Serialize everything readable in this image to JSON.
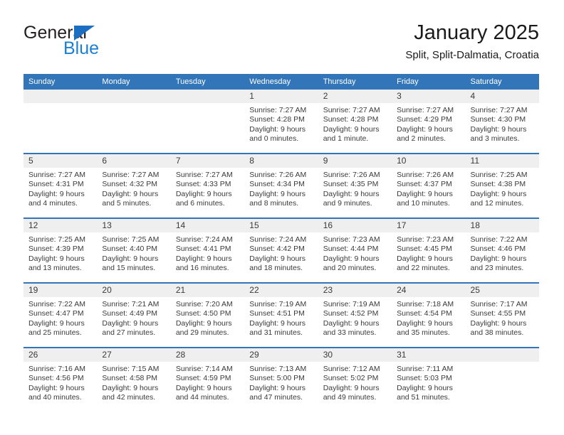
{
  "brand": {
    "name_part1": "General",
    "name_part2": "Blue",
    "triangle_color": "#1b6ec2",
    "blue_color": "#1b7fd4"
  },
  "header": {
    "title": "January 2025",
    "subtitle": "Split, Split-Dalmatia, Croatia"
  },
  "colors": {
    "header_blue": "#3275b8",
    "daynum_band": "#efefef",
    "text": "#3a3a3a"
  },
  "weekday_headers": [
    "Sunday",
    "Monday",
    "Tuesday",
    "Wednesday",
    "Thursday",
    "Friday",
    "Saturday"
  ],
  "weeks": [
    [
      {
        "day": "",
        "empty": true
      },
      {
        "day": "",
        "empty": true
      },
      {
        "day": "",
        "empty": true
      },
      {
        "day": "1",
        "sunrise": "Sunrise: 7:27 AM",
        "sunset": "Sunset: 4:28 PM",
        "daylight1": "Daylight: 9 hours",
        "daylight2": "and 0 minutes."
      },
      {
        "day": "2",
        "sunrise": "Sunrise: 7:27 AM",
        "sunset": "Sunset: 4:28 PM",
        "daylight1": "Daylight: 9 hours",
        "daylight2": "and 1 minute."
      },
      {
        "day": "3",
        "sunrise": "Sunrise: 7:27 AM",
        "sunset": "Sunset: 4:29 PM",
        "daylight1": "Daylight: 9 hours",
        "daylight2": "and 2 minutes."
      },
      {
        "day": "4",
        "sunrise": "Sunrise: 7:27 AM",
        "sunset": "Sunset: 4:30 PM",
        "daylight1": "Daylight: 9 hours",
        "daylight2": "and 3 minutes."
      }
    ],
    [
      {
        "day": "5",
        "sunrise": "Sunrise: 7:27 AM",
        "sunset": "Sunset: 4:31 PM",
        "daylight1": "Daylight: 9 hours",
        "daylight2": "and 4 minutes."
      },
      {
        "day": "6",
        "sunrise": "Sunrise: 7:27 AM",
        "sunset": "Sunset: 4:32 PM",
        "daylight1": "Daylight: 9 hours",
        "daylight2": "and 5 minutes."
      },
      {
        "day": "7",
        "sunrise": "Sunrise: 7:27 AM",
        "sunset": "Sunset: 4:33 PM",
        "daylight1": "Daylight: 9 hours",
        "daylight2": "and 6 minutes."
      },
      {
        "day": "8",
        "sunrise": "Sunrise: 7:26 AM",
        "sunset": "Sunset: 4:34 PM",
        "daylight1": "Daylight: 9 hours",
        "daylight2": "and 8 minutes."
      },
      {
        "day": "9",
        "sunrise": "Sunrise: 7:26 AM",
        "sunset": "Sunset: 4:35 PM",
        "daylight1": "Daylight: 9 hours",
        "daylight2": "and 9 minutes."
      },
      {
        "day": "10",
        "sunrise": "Sunrise: 7:26 AM",
        "sunset": "Sunset: 4:37 PM",
        "daylight1": "Daylight: 9 hours",
        "daylight2": "and 10 minutes."
      },
      {
        "day": "11",
        "sunrise": "Sunrise: 7:25 AM",
        "sunset": "Sunset: 4:38 PM",
        "daylight1": "Daylight: 9 hours",
        "daylight2": "and 12 minutes."
      }
    ],
    [
      {
        "day": "12",
        "sunrise": "Sunrise: 7:25 AM",
        "sunset": "Sunset: 4:39 PM",
        "daylight1": "Daylight: 9 hours",
        "daylight2": "and 13 minutes."
      },
      {
        "day": "13",
        "sunrise": "Sunrise: 7:25 AM",
        "sunset": "Sunset: 4:40 PM",
        "daylight1": "Daylight: 9 hours",
        "daylight2": "and 15 minutes."
      },
      {
        "day": "14",
        "sunrise": "Sunrise: 7:24 AM",
        "sunset": "Sunset: 4:41 PM",
        "daylight1": "Daylight: 9 hours",
        "daylight2": "and 16 minutes."
      },
      {
        "day": "15",
        "sunrise": "Sunrise: 7:24 AM",
        "sunset": "Sunset: 4:42 PM",
        "daylight1": "Daylight: 9 hours",
        "daylight2": "and 18 minutes."
      },
      {
        "day": "16",
        "sunrise": "Sunrise: 7:23 AM",
        "sunset": "Sunset: 4:44 PM",
        "daylight1": "Daylight: 9 hours",
        "daylight2": "and 20 minutes."
      },
      {
        "day": "17",
        "sunrise": "Sunrise: 7:23 AM",
        "sunset": "Sunset: 4:45 PM",
        "daylight1": "Daylight: 9 hours",
        "daylight2": "and 22 minutes."
      },
      {
        "day": "18",
        "sunrise": "Sunrise: 7:22 AM",
        "sunset": "Sunset: 4:46 PM",
        "daylight1": "Daylight: 9 hours",
        "daylight2": "and 23 minutes."
      }
    ],
    [
      {
        "day": "19",
        "sunrise": "Sunrise: 7:22 AM",
        "sunset": "Sunset: 4:47 PM",
        "daylight1": "Daylight: 9 hours",
        "daylight2": "and 25 minutes."
      },
      {
        "day": "20",
        "sunrise": "Sunrise: 7:21 AM",
        "sunset": "Sunset: 4:49 PM",
        "daylight1": "Daylight: 9 hours",
        "daylight2": "and 27 minutes."
      },
      {
        "day": "21",
        "sunrise": "Sunrise: 7:20 AM",
        "sunset": "Sunset: 4:50 PM",
        "daylight1": "Daylight: 9 hours",
        "daylight2": "and 29 minutes."
      },
      {
        "day": "22",
        "sunrise": "Sunrise: 7:19 AM",
        "sunset": "Sunset: 4:51 PM",
        "daylight1": "Daylight: 9 hours",
        "daylight2": "and 31 minutes."
      },
      {
        "day": "23",
        "sunrise": "Sunrise: 7:19 AM",
        "sunset": "Sunset: 4:52 PM",
        "daylight1": "Daylight: 9 hours",
        "daylight2": "and 33 minutes."
      },
      {
        "day": "24",
        "sunrise": "Sunrise: 7:18 AM",
        "sunset": "Sunset: 4:54 PM",
        "daylight1": "Daylight: 9 hours",
        "daylight2": "and 35 minutes."
      },
      {
        "day": "25",
        "sunrise": "Sunrise: 7:17 AM",
        "sunset": "Sunset: 4:55 PM",
        "daylight1": "Daylight: 9 hours",
        "daylight2": "and 38 minutes."
      }
    ],
    [
      {
        "day": "26",
        "sunrise": "Sunrise: 7:16 AM",
        "sunset": "Sunset: 4:56 PM",
        "daylight1": "Daylight: 9 hours",
        "daylight2": "and 40 minutes."
      },
      {
        "day": "27",
        "sunrise": "Sunrise: 7:15 AM",
        "sunset": "Sunset: 4:58 PM",
        "daylight1": "Daylight: 9 hours",
        "daylight2": "and 42 minutes."
      },
      {
        "day": "28",
        "sunrise": "Sunrise: 7:14 AM",
        "sunset": "Sunset: 4:59 PM",
        "daylight1": "Daylight: 9 hours",
        "daylight2": "and 44 minutes."
      },
      {
        "day": "29",
        "sunrise": "Sunrise: 7:13 AM",
        "sunset": "Sunset: 5:00 PM",
        "daylight1": "Daylight: 9 hours",
        "daylight2": "and 47 minutes."
      },
      {
        "day": "30",
        "sunrise": "Sunrise: 7:12 AM",
        "sunset": "Sunset: 5:02 PM",
        "daylight1": "Daylight: 9 hours",
        "daylight2": "and 49 minutes."
      },
      {
        "day": "31",
        "sunrise": "Sunrise: 7:11 AM",
        "sunset": "Sunset: 5:03 PM",
        "daylight1": "Daylight: 9 hours",
        "daylight2": "and 51 minutes."
      },
      {
        "day": "",
        "empty": true
      }
    ]
  ]
}
